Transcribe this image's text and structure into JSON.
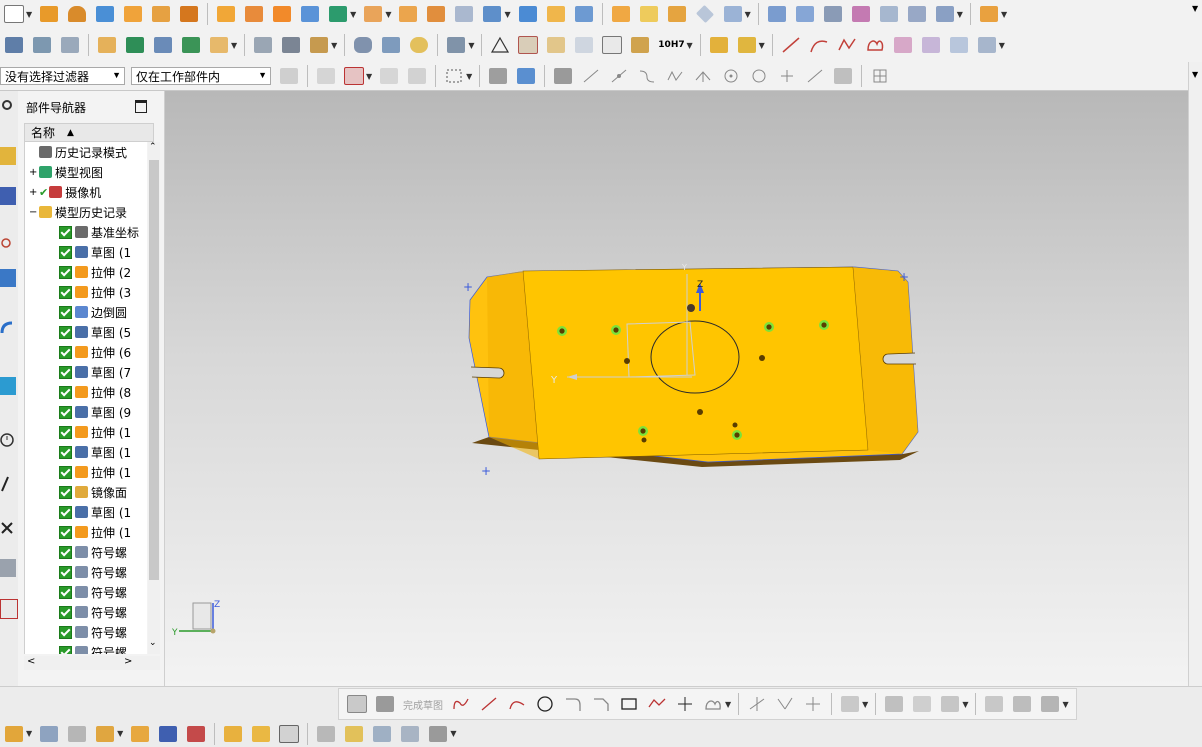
{
  "filter": {
    "selection_filter": "没有选择过滤器",
    "scope": "仅在工作部件内"
  },
  "navigator": {
    "title": "部件导航器",
    "column_header": "名称",
    "items": [
      {
        "label": "历史记录模式",
        "icon": "clock-icon",
        "expander": ""
      },
      {
        "label": "模型视图",
        "icon": "model-view-icon",
        "expander": "+"
      },
      {
        "label": "摄像机",
        "icon": "camera-icon",
        "expander": "+"
      },
      {
        "label": "模型历史记录",
        "icon": "folder-icon",
        "expander": "−"
      },
      {
        "label": "基准坐标",
        "icon": "datum-csys-icon"
      },
      {
        "label": "草图 (1",
        "icon": "sketch-icon"
      },
      {
        "label": "拉伸 (2",
        "icon": "extrude-icon"
      },
      {
        "label": "拉伸 (3",
        "icon": "extrude-icon"
      },
      {
        "label": "边倒圆",
        "icon": "edge-blend-icon"
      },
      {
        "label": "草图 (5",
        "icon": "sketch-icon"
      },
      {
        "label": "拉伸 (6",
        "icon": "extrude-icon"
      },
      {
        "label": "草图 (7",
        "icon": "sketch-icon"
      },
      {
        "label": "拉伸 (8",
        "icon": "extrude-icon"
      },
      {
        "label": "草图 (9",
        "icon": "sketch-icon"
      },
      {
        "label": "拉伸 (1",
        "icon": "extrude-icon"
      },
      {
        "label": "草图 (1",
        "icon": "sketch-icon"
      },
      {
        "label": "拉伸 (1",
        "icon": "extrude-icon"
      },
      {
        "label": "镜像面",
        "icon": "mirror-face-icon"
      },
      {
        "label": "草图 (1",
        "icon": "sketch-icon"
      },
      {
        "label": "拉伸 (1",
        "icon": "extrude-icon"
      },
      {
        "label": "符号螺",
        "icon": "thread-icon"
      },
      {
        "label": "符号螺",
        "icon": "thread-icon"
      },
      {
        "label": "符号螺",
        "icon": "thread-icon"
      },
      {
        "label": "符号螺",
        "icon": "thread-icon"
      },
      {
        "label": "符号螺",
        "icon": "thread-icon"
      },
      {
        "label": "符号螺",
        "icon": "thread-icon"
      }
    ]
  },
  "sketch_toolbar": {
    "finish_sketch_label": "完成草图"
  },
  "toolbar": {
    "fit_label": "10H7"
  },
  "viewport": {
    "axis_labels": {
      "x": "Y",
      "z": "Z",
      "y_top": "Y"
    },
    "triad_labels": {
      "z": "Z",
      "y": "Y"
    }
  },
  "colors": {
    "part_face": "#FFC20E",
    "part_side": "#E4A400",
    "part_bottom": "#6B4A12",
    "hole_green": "#7CE23A",
    "accent_blue": "#3B5BDB"
  }
}
